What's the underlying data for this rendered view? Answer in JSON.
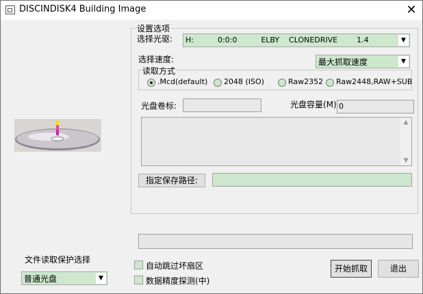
{
  "window": {
    "title": "DISCINDISK4 Building Image",
    "close_glyph": "✕"
  },
  "settings": {
    "group_title": "设置选项",
    "drive_label": "选择光驱:",
    "drive_value": "H:          0:0:0          ELBY    CLONEDRIVE        1.4",
    "speed_label": "选择速度:",
    "speed_value": "最大抓取速度",
    "read_mode": {
      "title": "读取方式",
      "options": [
        ".Mcd(default)",
        "2048 (ISO)",
        "Raw2352",
        "Raw2448,RAW+SUB"
      ],
      "selected": 0
    },
    "volume_label": "光盘卷标:",
    "volume_value": "",
    "capacity_label": "光盘容量(M):",
    "capacity_value": "0",
    "info_text": "",
    "path_button": "指定保存路径:",
    "path_value": ""
  },
  "progress": 0,
  "protection": {
    "label": "文件读取保护选择",
    "value": "普通光盘"
  },
  "options": {
    "auto_skip": "自动跳过坏扇区",
    "precision_detect": "数据精度探测(中)"
  },
  "buttons": {
    "start": "开始抓取",
    "exit": "退出"
  }
}
